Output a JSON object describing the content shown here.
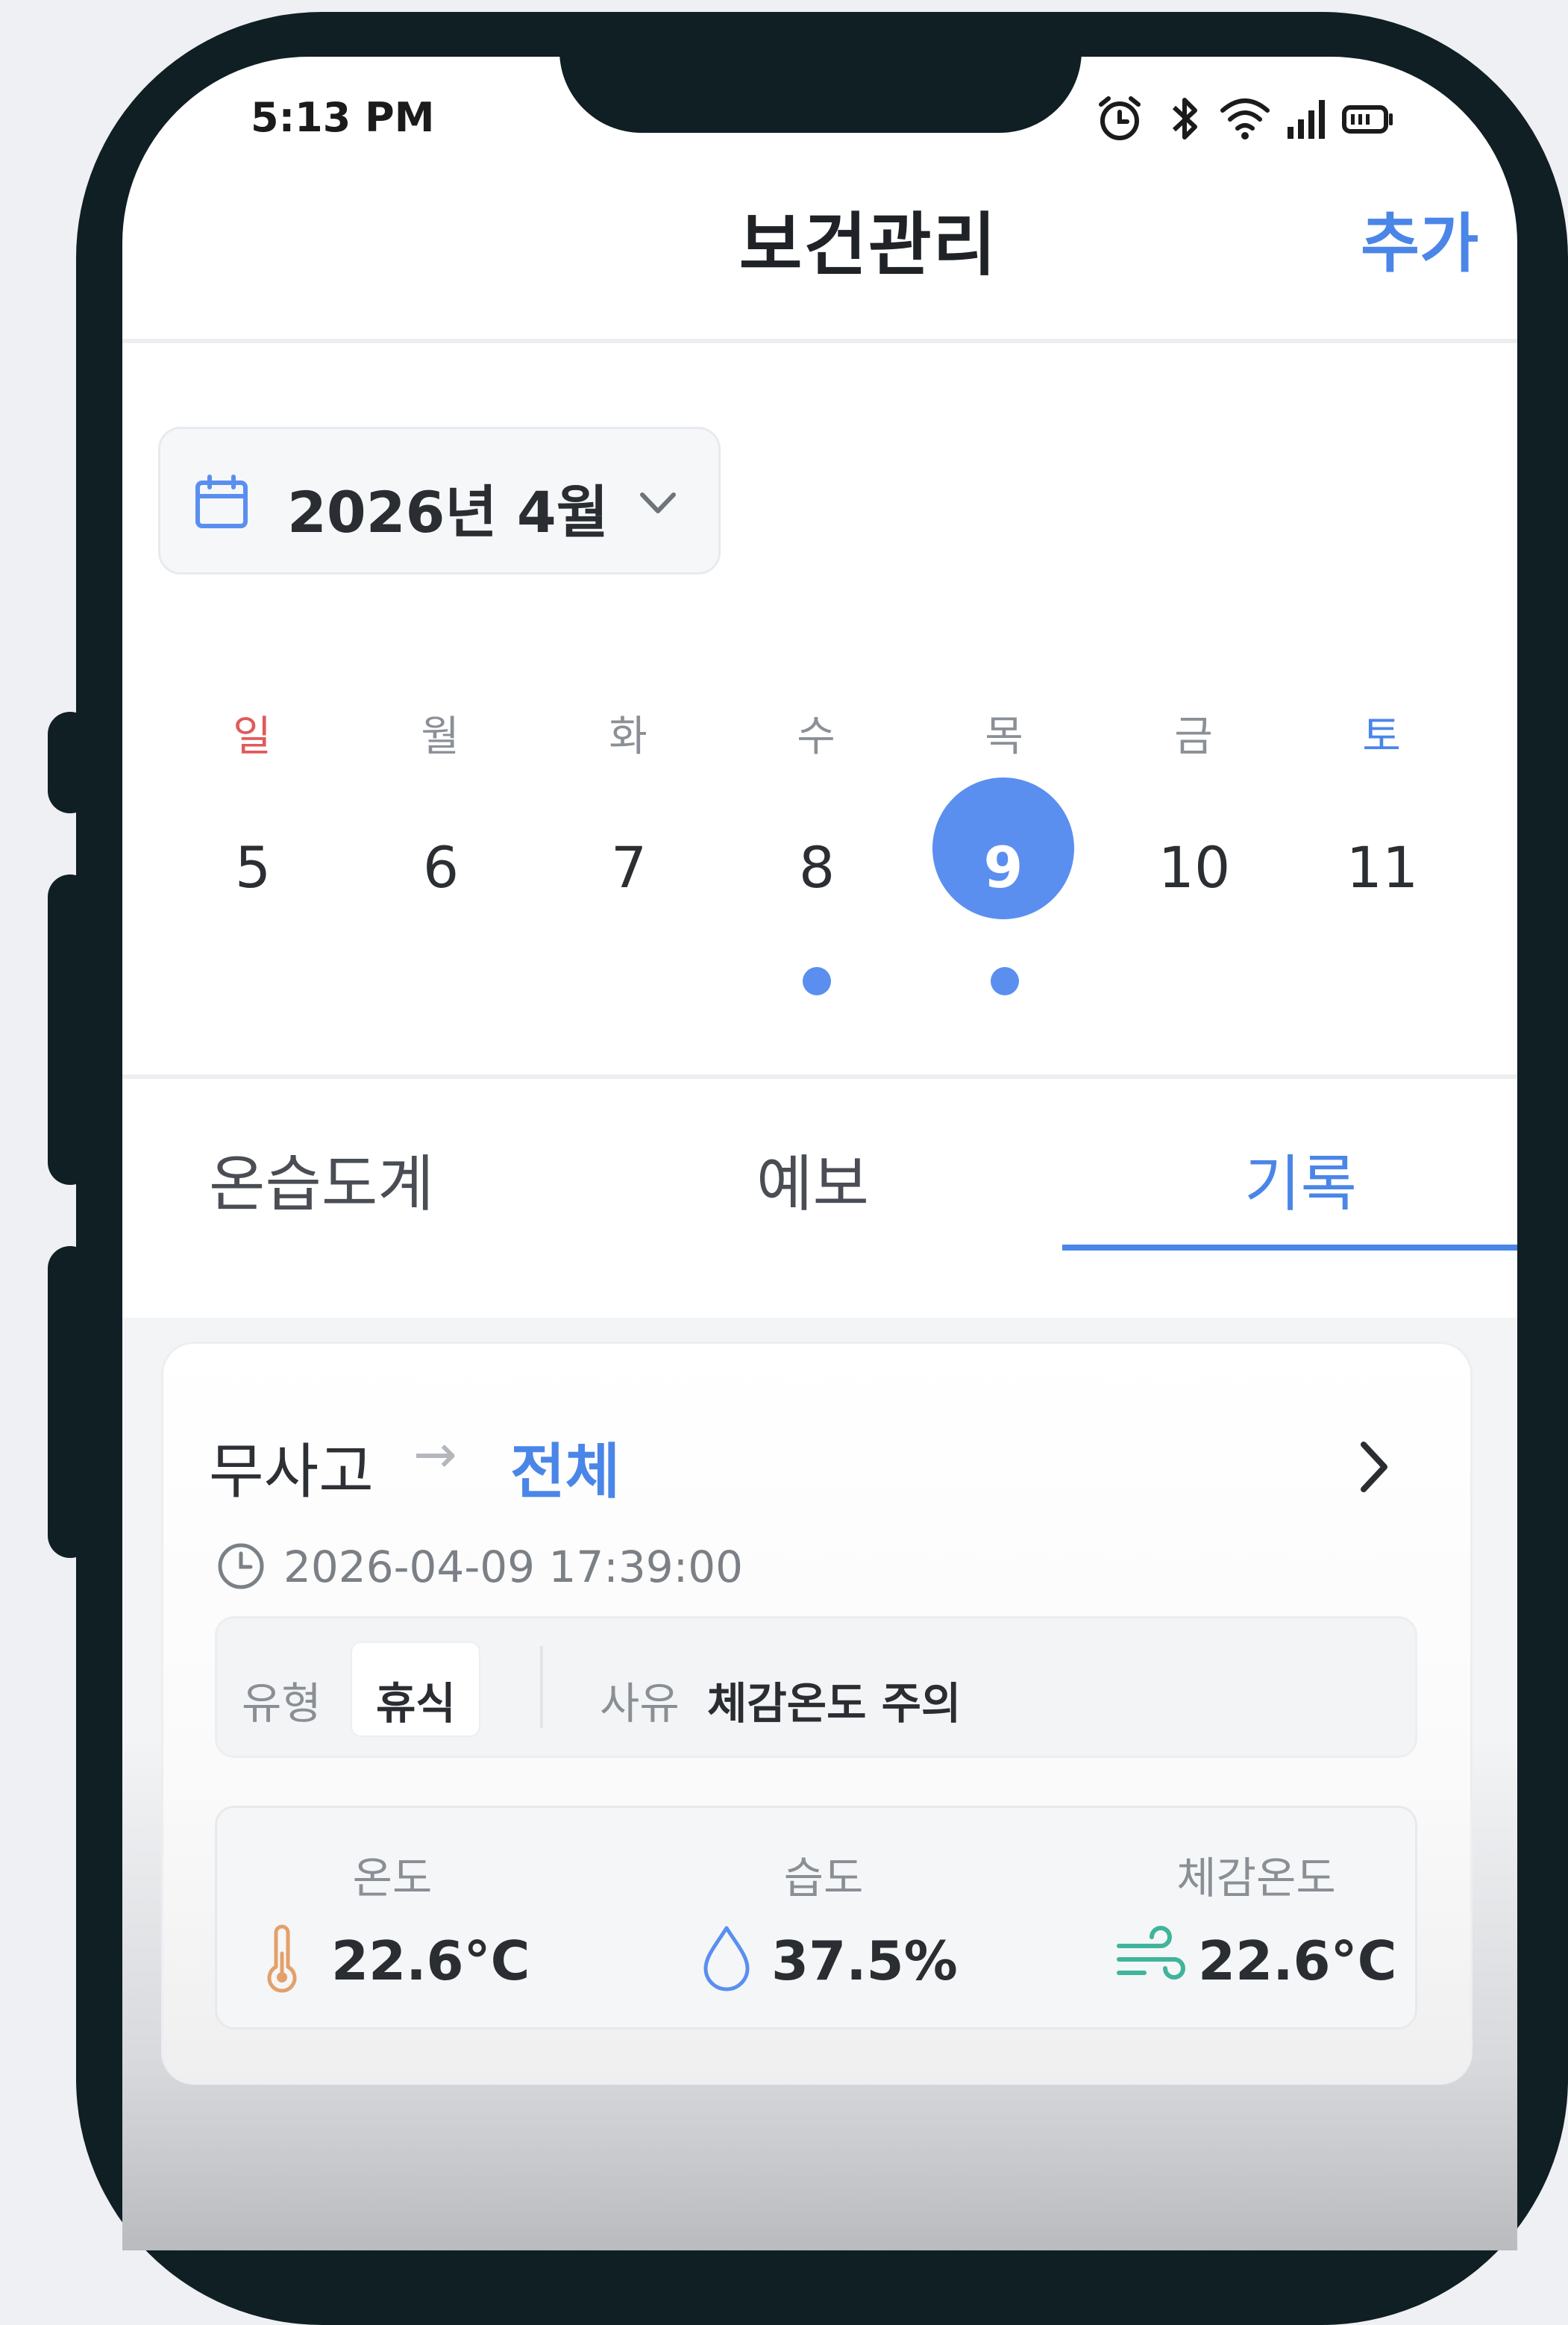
{
  "status_bar": {
    "time": "5:13 PM"
  },
  "header": {
    "title": "보건관리",
    "add_label": "추가"
  },
  "month_picker": {
    "label": "2026년 4월"
  },
  "week": {
    "days": [
      "일",
      "월",
      "화",
      "수",
      "목",
      "금",
      "토"
    ],
    "dates": [
      "5",
      "6",
      "7",
      "8",
      "9",
      "10",
      "11"
    ],
    "selected": "9",
    "has_records": [
      "8",
      "9"
    ]
  },
  "tabs": [
    {
      "label": "온습도계",
      "active": false
    },
    {
      "label": "예보",
      "active": false
    },
    {
      "label": "기록",
      "active": true
    }
  ],
  "record": {
    "from": "무사고",
    "arrow": "→",
    "to": "전체",
    "timestamp": "2026-04-09 17:39:00",
    "type_key": "유형",
    "type_value": "휴식",
    "reason_key": "사유",
    "reason_value": "체감온도 주의",
    "metrics": [
      {
        "label": "온도",
        "value": "22.6°C",
        "icon": "thermometer-icon"
      },
      {
        "label": "습도",
        "value": "37.5%",
        "icon": "water-drop-icon"
      },
      {
        "label": "체감온도",
        "value": "22.6°C",
        "icon": "wind-icon"
      }
    ]
  },
  "colors": {
    "accent": "#4a86e8",
    "sunday": "#e05a5a",
    "saturday": "#4a86e8",
    "frame": "#0f1f24"
  }
}
